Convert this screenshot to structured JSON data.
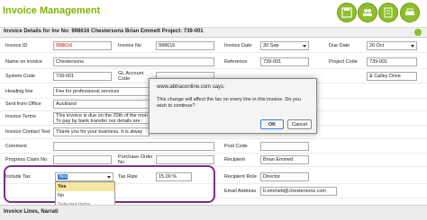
{
  "app": {
    "title": "Invoice Management",
    "subtitle": "Invoice Details for Inv No: 998616 Chestersons Brian Emmett Project: 739-001"
  },
  "form": {
    "invoice_id": {
      "label": "Invoice ID",
      "value": "998616"
    },
    "invoice_no": {
      "label": "Invoice No",
      "value": "998616"
    },
    "invoice_date": {
      "label": "Invoice Date",
      "value": "30 Sep"
    },
    "due_date": {
      "label": "Due Date",
      "value": "20 Oct"
    },
    "name_on_invoice": {
      "label": "Name on invoice",
      "value": "Chestersons"
    },
    "reference": {
      "label": "Reference",
      "value": "739-001"
    },
    "project_code": {
      "label": "Project Code",
      "value": "739-001"
    },
    "system_code": {
      "label": "System Code",
      "value": "739-001"
    },
    "gl_account_code": {
      "label": "GL Account Code",
      "value": ""
    },
    "address_partial": {
      "value": "& Calley Drive"
    },
    "heading_line": {
      "label": "Heading line",
      "value": "Fee for professional services"
    },
    "sent_from_office": {
      "label": "Sent from Office",
      "value": "Auckland"
    },
    "invoice_terms": {
      "label": "Invoice Terms",
      "line1": "This invoice is due on the 20th of the mon",
      "line2": "To pay by bank transfer our details are :"
    },
    "invoice_contact_text": {
      "label": "Invoice Contact Text",
      "value": "Thank you for your business. It is alway"
    },
    "comment": {
      "label": "Comment",
      "value": ""
    },
    "post_code": {
      "label": "Post Code",
      "value": ""
    },
    "progress_claim_no": {
      "label": "Progress Claim No",
      "value": ""
    },
    "purchase_order_no": {
      "label": "Purchase Order No",
      "value": ""
    },
    "recipient": {
      "label": "Recipient",
      "value": "Brian Emmett"
    },
    "include_tax": {
      "label": "Include Tax",
      "value": "Yes"
    },
    "tax_rate": {
      "label": "Tax Rate",
      "value": "15.00 %"
    },
    "recipient_role": {
      "label": "Recipient Role",
      "value": "Director"
    },
    "email_address": {
      "label": "Email Address",
      "value": "b.emmett@chestersons.com"
    }
  },
  "dropdown": {
    "options": [
      "Yes",
      "No"
    ],
    "footer": "Selected Items"
  },
  "modal": {
    "title": "www.abtraconline.com says:",
    "message": "This change will affect the tax on every line in this invoice. Do you wish to continue?",
    "ok": "OK",
    "cancel": "Cancel"
  },
  "footer": {
    "label": "Invoice Lines, Narrati"
  },
  "colors": {
    "accent": "#8ebf2a",
    "highlight_border": "#7a2f8a"
  }
}
